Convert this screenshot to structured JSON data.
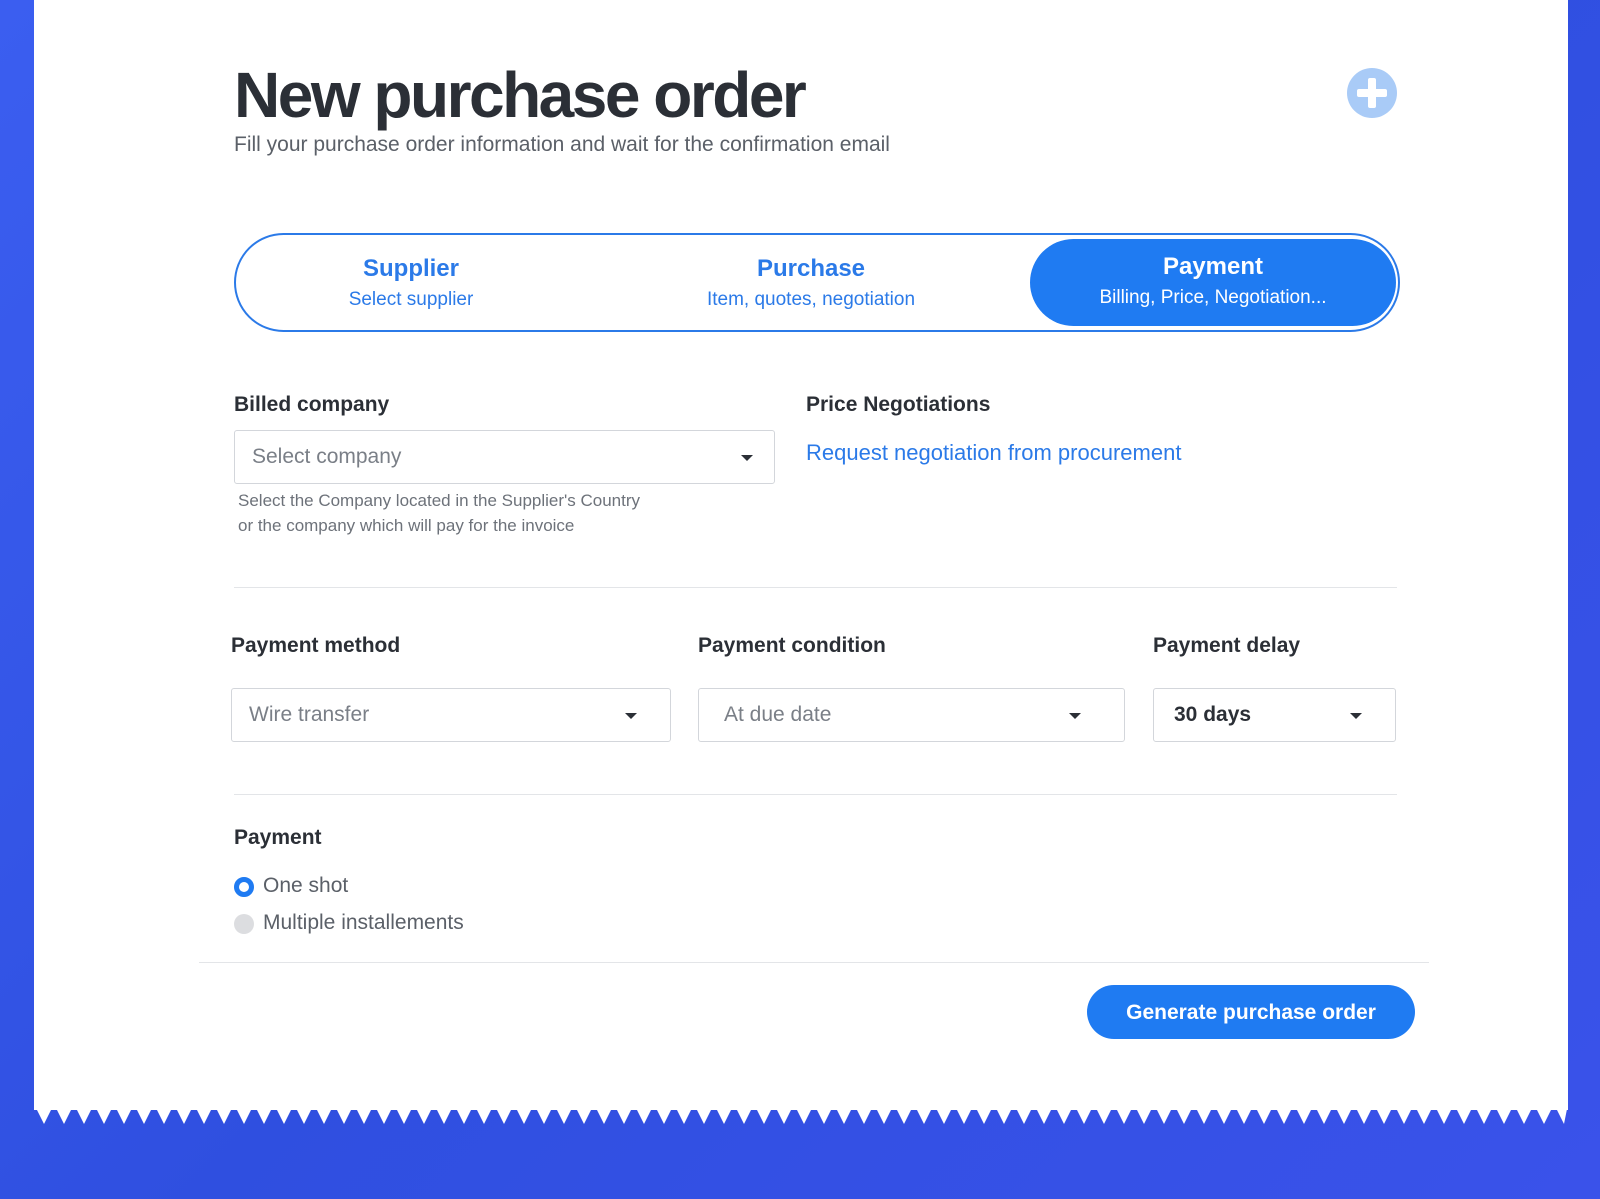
{
  "page": {
    "title": "New purchase order",
    "subtitle": "Fill your purchase order information and wait for the confirmation email",
    "add_icon": "plus-circle-icon"
  },
  "stepper": {
    "steps": [
      {
        "label": "Supplier",
        "description": "Select supplier",
        "active": false
      },
      {
        "label": "Purchase",
        "description": "Item, quotes, negotiation",
        "active": false
      },
      {
        "label": "Payment",
        "description": "Billing, Price, Negotiation...",
        "active": true
      }
    ]
  },
  "billing": {
    "label": "Billed company",
    "placeholder": "Select company",
    "help_line1": "Select the Company located in the Supplier's Country",
    "help_line2": "or the company which will pay for the invoice"
  },
  "negotiation": {
    "label": "Price Negotiations",
    "link": "Request negotiation from procurement"
  },
  "payment_method": {
    "label": "Payment method",
    "value": "Wire transfer"
  },
  "payment_condition": {
    "label": "Payment condition",
    "value": "At due date"
  },
  "payment_delay": {
    "label": "Payment delay",
    "value": "30 days"
  },
  "payment": {
    "label": "Payment",
    "options": [
      {
        "label": "One shot",
        "selected": true
      },
      {
        "label": "Multiple installements",
        "selected": false
      }
    ]
  },
  "actions": {
    "generate": "Generate purchase order"
  },
  "colors": {
    "primary": "#1f7bf2",
    "background": "#3b5ef0",
    "text": "#2b2f36"
  }
}
